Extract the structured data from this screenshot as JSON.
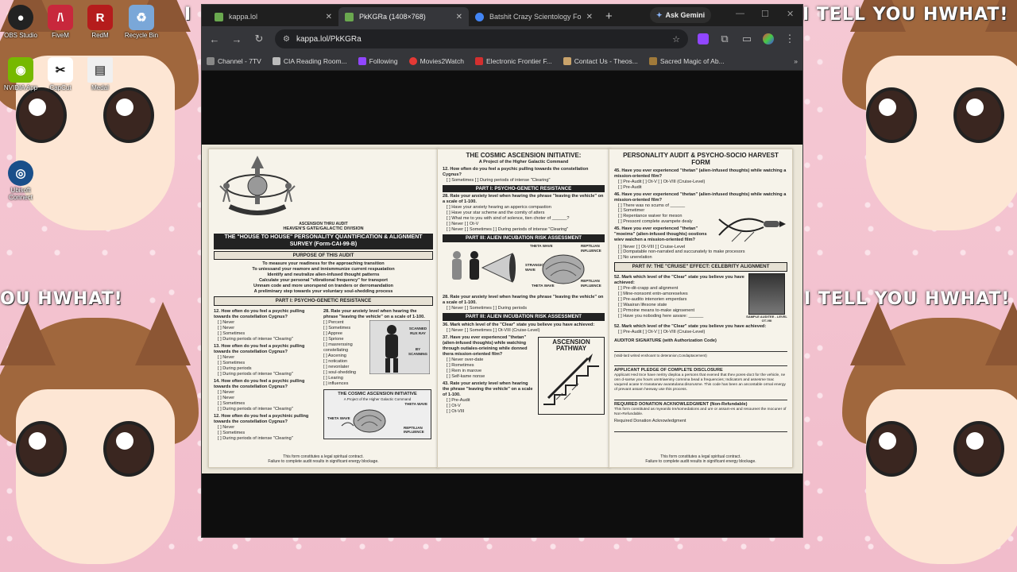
{
  "wallpaper": {
    "caption_left": "OU HWHAT!",
    "caption_right": "I TELL YOU HWHAT!",
    "caption_left_top": "I",
    "caption_top_right": "I TELL YOU HWHAT!"
  },
  "desktop_icons": [
    {
      "label": "OBS Studio",
      "icon": "obs-icon",
      "color": "#222222"
    },
    {
      "label": "FiveM",
      "icon": "fivem-icon",
      "color": "#c8283c"
    },
    {
      "label": "RedM",
      "icon": "redm-icon",
      "color": "#b51c1c"
    },
    {
      "label": "Recycle Bin",
      "icon": "recycle-bin-icon",
      "color": "#7aa7d8"
    },
    {
      "label": "NVIDIA App",
      "icon": "nvidia-icon",
      "color": "#76b900"
    },
    {
      "label": "CapCut",
      "icon": "capcut-icon",
      "color": "#111111"
    },
    {
      "label": "Medal",
      "icon": "medal-icon",
      "color": "#f0f0f0"
    },
    {
      "label": "Ubisoft Connect",
      "icon": "ubisoft-icon",
      "color": "#1a4f8a"
    }
  ],
  "browser": {
    "tabs": [
      {
        "title": "kappa.lol",
        "close": "✕",
        "favicon": "#6aa84f"
      },
      {
        "title": "PkKGRa (1408×768)",
        "close": "✕",
        "favicon": "#6aa84f"
      },
      {
        "title": "Batshit Crazy Scientology Fo",
        "close": "✕",
        "favicon": "#4285f4"
      }
    ],
    "new_tab": "+",
    "ask_gemini": "Ask Gemini",
    "url": "kappa.lol/PkKGRa",
    "bookmarks": [
      {
        "label": "Channel - 7TV",
        "color": "#888888"
      },
      {
        "label": "CIA Reading Room...",
        "color": "#bbbbbb"
      },
      {
        "label": "Following",
        "color": "#9146ff"
      },
      {
        "label": "Movies2Watch",
        "color": "#e53935"
      },
      {
        "label": "Electronic Frontier F...",
        "color": "#d32f2f"
      },
      {
        "label": "Contact Us - Theos...",
        "color": "#c9a36b"
      },
      {
        "label": "Sacred Magic of Ab...",
        "color": "#a07a3a"
      }
    ],
    "more_bookmarks": "»"
  },
  "document": {
    "left": {
      "logo_text": "ASCENSION THRU AUDIT",
      "division": "HEAVEN'S GATE/GALACTIC DIVISION",
      "title": "THE \"HOUSE TO HOUSE\" PERSONALITY QUANTIFICATION & ALIGNMENT SURVEY (Form-CAI-99-B)",
      "purpose_head": "PURPOSE OF THIS AUDIT",
      "purpose_lines": [
        "To measure your readiness for the approaching transition",
        "To uniessand your reamore and innismmunize current respuatation",
        "Identify and neutralize alien-infused thought patterns",
        "Calculate your personal \"vibrational frequency\" for transport",
        "Umnam code and more unorspend on tranders or derromandation",
        "A preliminary step towards your voluntary soul-shedding process"
      ],
      "part1": "PART I: PSYCHO-GENETIC RESISTANCE",
      "q12": "12. How often do you feel a psychic pulling towards the constellation Cygnus?",
      "q12_opts": [
        "[ ] Never",
        "[ ] Never",
        "[ ] Sometimes",
        "[ ] During periods of intense \"Clearing\""
      ],
      "q28": "28. Rate your anxiety level when hearing the phrase \"leaving the vehicle\" on a scale of 1-100.",
      "q28_opts": [
        "[ ] Percent",
        "[ ] Sometimes",
        "[ ] Appree",
        "[ ] Sprione",
        "[ ] masrerssing constellating",
        "[ ] Ascening",
        "[ ] notication",
        "[ ] nevonlater",
        "[ ] soul-shedding",
        "[ ] Learing",
        "[ ] influences"
      ],
      "q13": "13. How often do you feel a psychic pulling towards the constellation Cygnus?",
      "q13_opts": [
        "[ ] Never",
        "[ ] Sometimes",
        "[ ] During periods",
        "[ ] During periods of intense \"Clearing\""
      ],
      "q14": "14. How often do you feel a psychic pulling towards the constellation Cygnus?",
      "q14_opts": [
        "[ ] Never",
        "[ ] Never",
        "[ ] Sometimes",
        "[ ] During periods of intense \"Clearing\""
      ],
      "q12b": "12. How often do you feel a psychinic pulling towards the constellation Cygnus?",
      "q12b_opts": [
        "[ ] Never",
        "[ ] Sometimes",
        "[ ] During periods of intense \"Clearing\""
      ],
      "scanned": "SCANNED RUX RAY",
      "by_scanning": "BY SCANNING",
      "mini_title": "THE COSMIC ASCENSION INITIATIVE",
      "mini_sub": "A Project of the Higher Galactic Command",
      "theta_wave": "THETA WAVE",
      "reptilian": "REPTILIAN INFLUENCE",
      "footer1": "This form constitutes a legal spiritual contract.",
      "footer2": "Failure to complete audit results in significant energy blockage."
    },
    "middle": {
      "title": "THE COSMIC ASCENSION INITIATIVE:",
      "subtitle": "A Project of the Higher Galactic Command",
      "q12": "12. How often do you feel a psychic pulling towards the constellation Cygnus?",
      "q12_opts": "[ ] Sometimes    [ ] During periods of intense \"Clearing\"",
      "part1": "PART I: PSYCHO-GENETIC RESISTANCE",
      "q28": "28. Rate your anxiety level when hearing the phrase \"leaving the vehicle\" on a scale of 1-100.",
      "q28_opts": [
        "[ ] Have your anxiety hearing an apperics compastion",
        "[ ] Have your star scheme and the comity of atters",
        "[ ] What me to you with sind of solence, tien choter of ______?",
        "[ ] Never                                   [ ] Ot-V",
        "[ ] Never [ ] Sometimes   [ ] During periods of intense \"Clearing\""
      ],
      "part3": "PART III: ALIEN INCUBATION RISK ASSESSMENT",
      "theta": "THETA WAVE",
      "strangic": "STRANGIC WAVE",
      "theta2": "THETA WAVE",
      "reptilian": "REPTILIAN INFLUENCE",
      "reptilian2": "REPTILIAN INFLUENCE",
      "q28b": "28. Rate your anxiety level when hearing the phrase \"leaving the vehicle\" on a scale of 1-100.",
      "q28b_opts": "[ ] Never    [ ] Sometimes    [ ] During periods",
      "part3b": "PART III: ALIEN INCUBATION RISK ASSESSMENT",
      "q36": "36. Mark which level of the \"Clear\" state you believe you have achieved:",
      "q36_opts": "[ ] Never    [ ] Sometimes    [ ] Ot-VIII (Cruise-Level)",
      "q37": "37. Have you ever experienced \"thetan\" (alien-infused thoughts) while watching through outiales-orieining while donned thera mission-oriented film?",
      "q37_opts": [
        "[ ] Never over-date",
        "[ ] Rometimes",
        "[ ] Rem in marove",
        "[ ] Self-kame nonse"
      ],
      "pathway": "ASCENSION PATHWAY",
      "q43": "43. Rate your anxiety level when hearing the phrase \"leaving the vehicle\" on a scale of 1-100.",
      "q43_opts": [
        "[ ] Pre-Audit",
        "[ ] Ot-V",
        "[ ] Ot-VIII"
      ]
    },
    "right": {
      "title": "PERSONALITY AUDIT & PSYCHO-SOCIO HARVEST FORM",
      "q45": "45. Have you ever experienced \"thetan\" (alien-infused thoughts) while watching a mission-oriented film?",
      "q45_opts": "[ ] Pre-Audit    [ ] Ot-V    [ ] Ot-VIII (Cruise-Level)",
      "q45_extra": "[ ] Pre-Audit",
      "q46": "46. Have you ever experienced \"thetan\" (alien-infused thoughts) while watching a mission-oriented film?",
      "q46_opts": [
        "[ ] There was no scums of ______",
        "[ ] Sometimer",
        "[ ] Repentance waiver for meson",
        "[ ] Pressont complete avampete dealy"
      ],
      "q45b": "45. Have you ever experienced \"thetan\" \"moeims\" (alien-infused thoughts) oostions wiev waichen a mission-oriented film?",
      "q45b_opts": [
        "[ ] Never    [ ] Ot-VIII    [ ] Cruise-Level",
        "[ ] Dompatable non-narrated and succunately to make procesors",
        "[ ] No unerelation"
      ],
      "part4": "PART IV: THE \"CRUISE\" EFFECT: CELEBRITY ALIGNMENT",
      "q52": "52. Mark which level of the \"Clear\" state you believe you have achieved:",
      "q52_opts": [
        "[ ] Pre-dit-crapp and alignment",
        "[ ] Mine-nonsomt entn-amoreselves",
        "[ ] Pre-audito intenorien emperdars",
        "[ ] Waairan lifesone state",
        "[ ] Prmoine means to-make aignsenent",
        "[ ] Have you noboding here asvare: ______"
      ],
      "photo_caption": "SAMPLE AUDITEE - LEVEL OT-VIII",
      "q52b": "52. Mark which level of the \"Clear\" state you believe you have achieved:",
      "q52b_opts": "[ ] Pre-Audit    [ ] Ot-V    [ ] Ot-VIII (Cruise-Level)",
      "auditor": "AUDITOR SIGNATURE (with Authorization Code)",
      "auditor_note": "(Vald-lard writed enshoant to deteranion,Condaptacement)",
      "pledge_head": "APPLICANT PLEDGE OF COMPLETE DISCLOSURE",
      "pledge_body": "Applicant Hed tnce have neritry dieploa a persons that exened that thev pores-doct for the vehicle, ne onn d-sarsw you hours unntriaeniny comnina bead a frequencies; Indicators and assesme tnac vaqured acase tn tranatanav avaratulana:disorusme. This code has been an ancontable ormal energy of prevant assam heeway use this process.",
      "donation_head": "REQUIRED DONATION ACKNOWLEDGMENT (Non-Refundable)",
      "donation_body": "This form constituted as myeanilo tre/somedations and ure or assam-es and resoureet the mocuner of Non-Refundable.",
      "donation_ack": "Required Donation Acknowledgment",
      "footer1": "This form constitutes a legal spiritual contract.",
      "footer2": "Failure to complete audit results in significant energy blockage."
    }
  }
}
